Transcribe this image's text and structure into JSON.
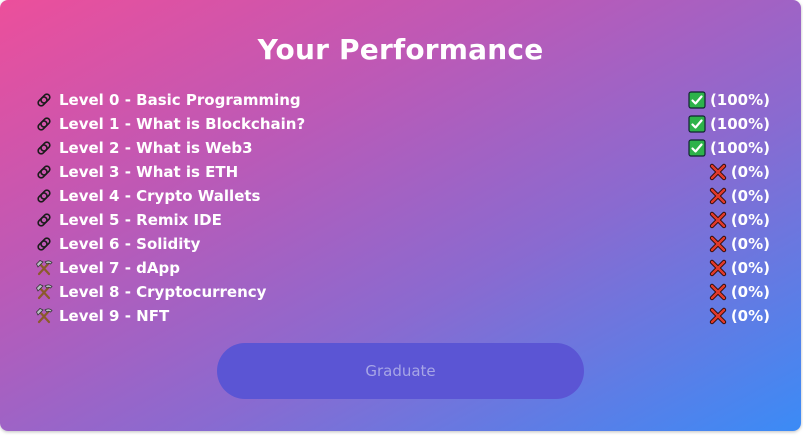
{
  "page": {
    "title": "Your Performance",
    "graduate_label": "Graduate"
  },
  "levels": [
    {
      "label": "Level 0 - Basic Programming",
      "percent": "(100%)",
      "icon": "paperclip-icon",
      "status": "check"
    },
    {
      "label": "Level 1 - What is Blockchain?",
      "percent": "(100%)",
      "icon": "paperclip-icon",
      "status": "check"
    },
    {
      "label": "Level 2 - What is Web3",
      "percent": "(100%)",
      "icon": "paperclip-icon",
      "status": "check"
    },
    {
      "label": "Level 3 - What is ETH",
      "percent": "(0%)",
      "icon": "paperclip-icon",
      "status": "cross"
    },
    {
      "label": "Level 4 - Crypto Wallets",
      "percent": "(0%)",
      "icon": "paperclip-icon",
      "status": "cross"
    },
    {
      "label": "Level 5 - Remix IDE",
      "percent": "(0%)",
      "icon": "paperclip-icon",
      "status": "cross"
    },
    {
      "label": "Level 6 - Solidity",
      "percent": "(0%)",
      "icon": "paperclip-icon",
      "status": "cross"
    },
    {
      "label": "Level 7 - dApp",
      "percent": "(0%)",
      "icon": "hammer-pick-icon",
      "status": "cross"
    },
    {
      "label": "Level 8 - Cryptocurrency",
      "percent": "(0%)",
      "icon": "hammer-pick-icon",
      "status": "cross"
    },
    {
      "label": "Level 9 - NFT",
      "percent": "(0%)",
      "icon": "hammer-pick-icon",
      "status": "cross"
    }
  ],
  "colors": {
    "gradient_start": "#ec4f9b",
    "gradient_end": "#3b8bf6",
    "check_green": "#2db24a",
    "cross_red": "#e23a2a",
    "button_bg": "#5b55d4",
    "button_text": "#a7a6e6"
  }
}
